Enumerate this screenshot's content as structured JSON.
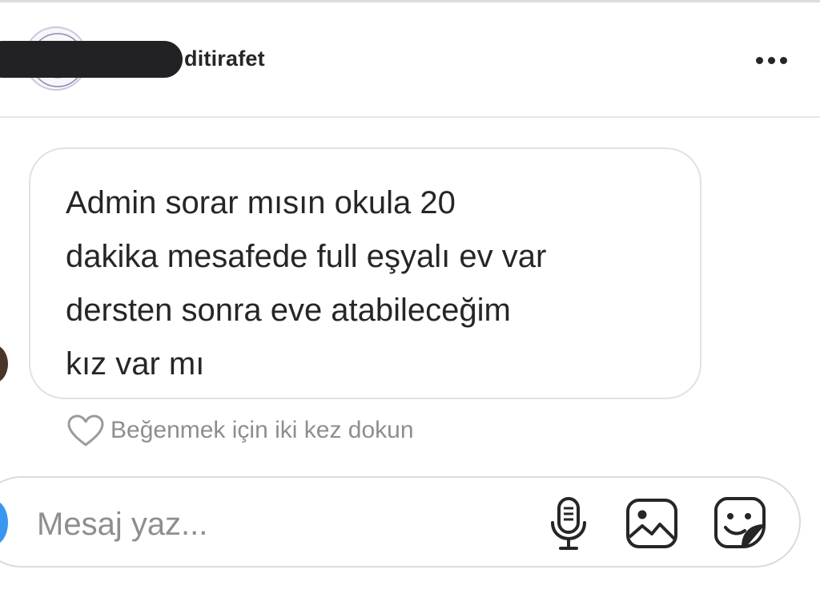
{
  "header": {
    "username": "ditirafet",
    "more_icon": "more-horizontal-icon"
  },
  "message": {
    "lines": [
      "Admin sorar mısın okula 20",
      "dakika mesafede full eşyalı ev var",
      "dersten sonra eve atabileceğim",
      "kız var mı"
    ],
    "like_hint": "Beğenmek için iki kez dokun"
  },
  "composer": {
    "placeholder": "Mesaj yaz...",
    "icons": [
      "microphone-icon",
      "gallery-icon",
      "sticker-icon"
    ]
  },
  "colors": {
    "text": "#262626",
    "secondary_text": "#8e8e8e",
    "border": "#dbdbdb",
    "accent_blue": "#3897f0",
    "redaction": "#222224"
  }
}
